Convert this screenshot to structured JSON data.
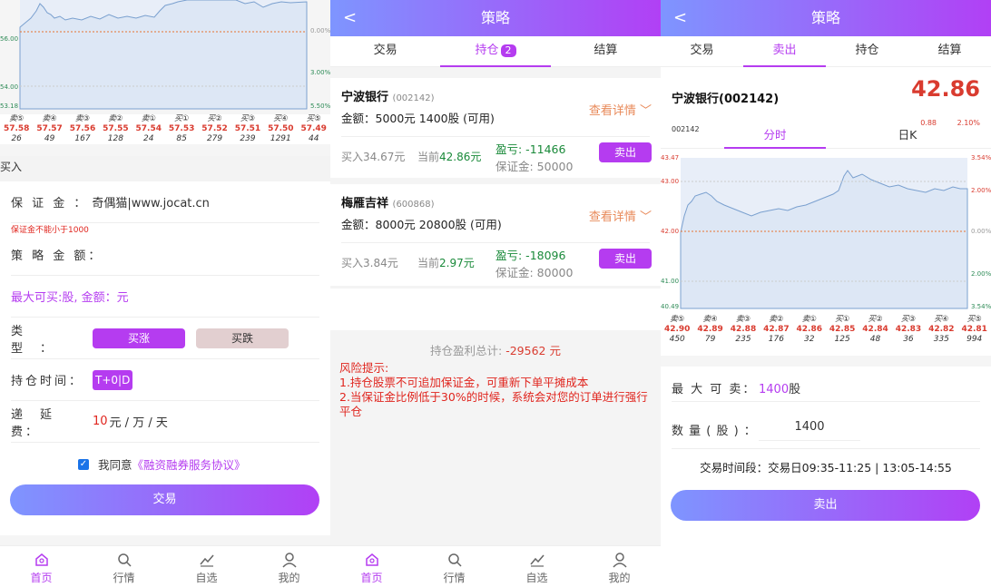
{
  "panel1": {
    "chart": {
      "y_ticks": [
        "56.00",
        "54.00",
        "53.18"
      ],
      "right_ticks": [
        "0.00%",
        "3.00%",
        "5.50%"
      ]
    },
    "trades": [
      {
        "side": "卖⑤",
        "price": "57.58",
        "vol": "26"
      },
      {
        "side": "卖④",
        "price": "57.57",
        "vol": "49"
      },
      {
        "side": "卖③",
        "price": "57.56",
        "vol": "167"
      },
      {
        "side": "卖②",
        "price": "57.55",
        "vol": "128"
      },
      {
        "side": "卖①",
        "price": "57.54",
        "vol": "24"
      },
      {
        "side": "买①",
        "price": "57.53",
        "vol": "85"
      },
      {
        "side": "买②",
        "price": "57.52",
        "vol": "279"
      },
      {
        "side": "买③",
        "price": "57.51",
        "vol": "239"
      },
      {
        "side": "买④",
        "price": "57.50",
        "vol": "1291"
      },
      {
        "side": "买⑤",
        "price": "57.49",
        "vol": "44"
      }
    ],
    "section_label": "买入",
    "form": {
      "margin_label": "保 证 金 ：",
      "margin_value": "奇偶猫|www.jocat.cn",
      "margin_hint": "保证金不能小于1000",
      "amount_label": "策 略 金 额：",
      "max_buy": "最大可买:股, 金额：元",
      "type_label": "类　　型　：",
      "type_up": "买涨",
      "type_down": "买跌",
      "hold_label": "持仓时间：",
      "hold_value": "T+0|D",
      "fee_label": "递　延　费：",
      "fee_value": "10",
      "fee_unit": "元 / 万 / 天",
      "agree_prefix": "我同意",
      "agree_link": "《融资融券服务协议》",
      "submit": "交易"
    }
  },
  "panel2": {
    "title": "策略",
    "tabs": [
      "交易",
      "持仓",
      "结算"
    ],
    "badge": "2",
    "positions": [
      {
        "name": "宁波银行",
        "code": "(002142)",
        "amount": "金额：5000元  1400股 (可用)",
        "detail": "查看详情",
        "buyin": "买入34.67元",
        "curr_prefix": "当前",
        "curr": "42.86元",
        "pl": "盈亏: -11466",
        "margin": "保证金: 50000",
        "sell": "卖出"
      },
      {
        "name": "梅雁吉祥",
        "code": "(600868)",
        "amount": "金额：8000元  20800股 (可用)",
        "detail": "查看详情",
        "buyin": "买入3.84元",
        "curr_prefix": "当前",
        "curr": "2.97元",
        "pl": "盈亏: -18096",
        "margin": "保证金: 80000",
        "sell": "卖出"
      }
    ],
    "total_label": "持仓盈利总计:",
    "total_value": "-29562 元",
    "risk_title": "风险提示:",
    "risk_1": "1.持仓股票不可追加保证金，可重新下单平摊成本",
    "risk_2": "2.当保证金比例低于30%的时候，系统会对您的订单进行强行平仓"
  },
  "panel3": {
    "title": "策略",
    "tabs": [
      "交易",
      "卖出",
      "持仓",
      "结算"
    ],
    "stock_name": "宁波银行(002142)",
    "price": "42.86",
    "code_small": "002142",
    "change": "0.88",
    "change_pct": "2.10%",
    "chart_tabs": [
      "分时",
      "日K"
    ],
    "chart": {
      "y_ticks": [
        "43.47",
        "43.00",
        "42.00",
        "41.00",
        "40.49"
      ],
      "right_ticks": [
        "3.54%",
        "2.00%",
        "0.00%",
        "2.00%",
        "3.54%"
      ]
    },
    "trades": [
      {
        "side": "卖⑤",
        "price": "42.90",
        "vol": "450"
      },
      {
        "side": "卖④",
        "price": "42.89",
        "vol": "79"
      },
      {
        "side": "卖③",
        "price": "42.88",
        "vol": "235"
      },
      {
        "side": "卖②",
        "price": "42.87",
        "vol": "176"
      },
      {
        "side": "卖①",
        "price": "42.86",
        "vol": "32"
      },
      {
        "side": "买①",
        "price": "42.85",
        "vol": "125"
      },
      {
        "side": "买②",
        "price": "42.84",
        "vol": "48"
      },
      {
        "side": "买③",
        "price": "42.83",
        "vol": "36"
      },
      {
        "side": "买④",
        "price": "42.82",
        "vol": "335"
      },
      {
        "side": "买⑤",
        "price": "42.81",
        "vol": "994"
      }
    ],
    "max_sell_label": "最 大 可 卖：",
    "max_sell_value": "1400",
    "max_sell_unit": "股",
    "qty_label": "数 量 ( 股 ) ：",
    "qty_value": "1400",
    "trade_time": "交易时间段：交易日09:35-11:25 | 13:05-14:55",
    "sell_btn": "卖出"
  },
  "tabbar": [
    "首页",
    "行情",
    "自选",
    "我的"
  ],
  "colors": {
    "accent": "#b53cf0",
    "gradient_start": "#7e95ff",
    "gradient_end": "#b140f5",
    "down": "#d93b2f",
    "gain": "#1a8a3a"
  }
}
